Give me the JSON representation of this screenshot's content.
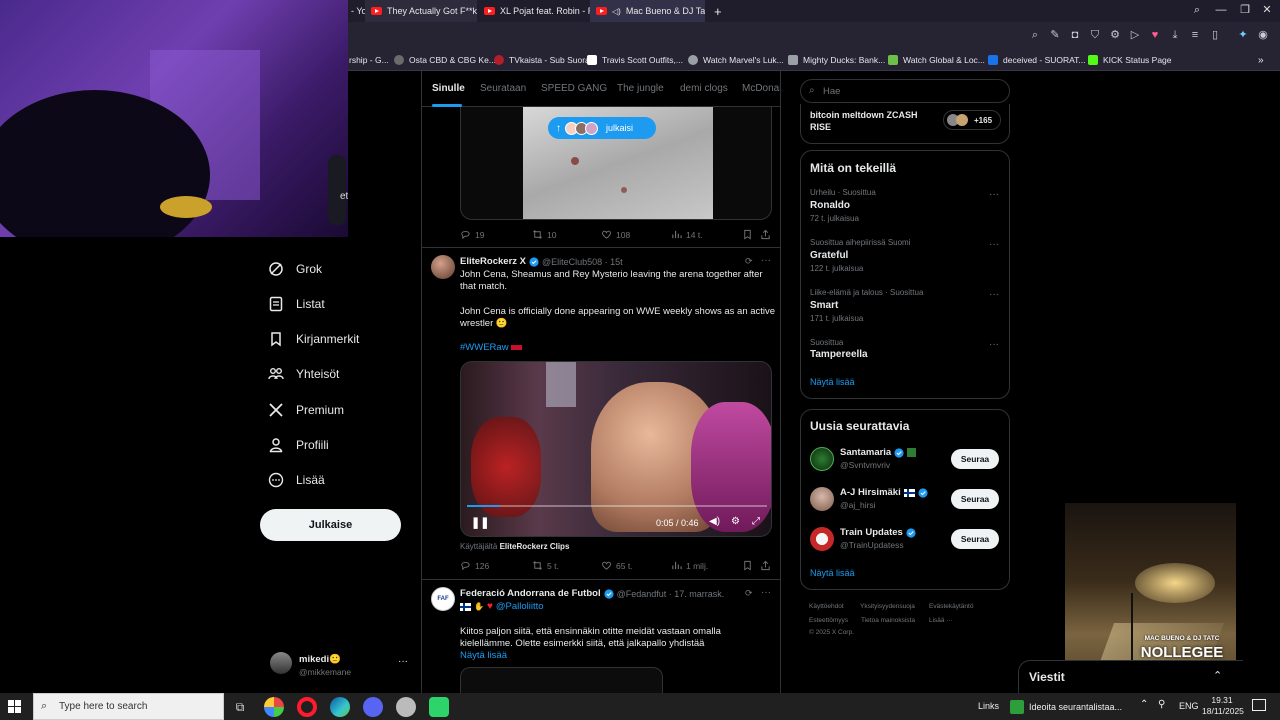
{
  "browser": {
    "tabs": [
      {
        "title": "- Yo"
      },
      {
        "title": "They Actually Got F**king"
      },
      {
        "title": "XL Pojat feat. Robin - Rom"
      },
      {
        "title": "Mac Bueno & DJ Tatc"
      }
    ],
    "bookmarks": [
      {
        "label": "rship - G...",
        "color": "#4b6b8a"
      },
      {
        "label": "Osta CBD & CBG Ke...",
        "color": "#6b6b6b"
      },
      {
        "label": "TVkaista - Sub Suora",
        "color": "#b31e2b"
      },
      {
        "label": "Travis Scott Outfits,...",
        "color": "#ffffff"
      },
      {
        "label": "Watch Marvel's Luk...",
        "color": "#9aa0a6"
      },
      {
        "label": "Mighty Ducks: Bank...",
        "color": "#9aa0a6"
      },
      {
        "label": "Watch Global & Loc...",
        "color": "#6cc04a"
      },
      {
        "label": "deceived - SUORAT...",
        "color": "#1a73e8"
      },
      {
        "label": "KICK Status Page",
        "color": "#53fc18"
      }
    ]
  },
  "webcam": {
    "partial_text": "et"
  },
  "nav": {
    "items": [
      {
        "label": "Grok",
        "icon": "grok-icon"
      },
      {
        "label": "Listat",
        "icon": "list-icon"
      },
      {
        "label": "Kirjanmerkit",
        "icon": "bookmark-icon"
      },
      {
        "label": "Yhteisöt",
        "icon": "communities-icon"
      },
      {
        "label": "Premium",
        "icon": "x-logo-icon"
      },
      {
        "label": "Profiili",
        "icon": "profile-icon"
      },
      {
        "label": "Lisää",
        "icon": "more-icon"
      }
    ],
    "post_label": "Julkaise",
    "profile": {
      "name": "mikedi🙂",
      "handle": "@mikkemane"
    }
  },
  "feed": {
    "tabs": [
      "Sinulle",
      "Seurataan",
      "SPEED GANG",
      "The jungle",
      "demi clogs",
      "McDonal"
    ],
    "new_posts_pill": "julkaisi",
    "top_tweet_metrics": {
      "replies": "19",
      "reposts": "10",
      "likes": "108",
      "views": "14 t."
    },
    "tweet1": {
      "name": "EliteRockerz X",
      "handle": "@EliteClub508 · 15t",
      "text1": "John Cena, Sheamus and Rey Mysterio leaving the arena together after that match.",
      "text2": "John Cena is officially done appearing on WWE weekly shows as an active wrestler 🙂",
      "hashtag": "#WWERaw",
      "video_time": "0:05 / 0:46",
      "from_prefix": "Käyttäjältä",
      "from_source": "EliteRockerz Clips",
      "metrics": {
        "replies": "126",
        "reposts": "5 t.",
        "likes": "65 t.",
        "views": "1 milj."
      }
    },
    "tweet2": {
      "name": "Federació Andorrana de Futbol",
      "handle": "@Fedandfut · 17. marrask.",
      "mention": "@Palloliitto",
      "text": "Kiitos paljon siitä, että ensinnäkin otitte meidät vastaan omalla kielellämme. Olette esimerkki siitä, että jalkapallo yhdistää",
      "show_more": "Näytä lisää"
    }
  },
  "right": {
    "search_placeholder": "Hae",
    "top_trend": {
      "title": "bitcoin meltdown ZCASH RISE",
      "count": "+165"
    },
    "trending_title": "Mitä on tekeillä",
    "trends": [
      {
        "meta": "Urheilu · Suosittua",
        "name": "Ronaldo",
        "posts": "72 t. julkaisua"
      },
      {
        "meta": "Suosittua aihepiirissä Suomi",
        "name": "Grateful",
        "posts": "122 t. julkaisua"
      },
      {
        "meta": "Liike-elämä ja talous · Suosittua",
        "name": "Smart",
        "posts": "171 t. julkaisua"
      },
      {
        "meta": "Suosittua",
        "name": "Tampereella",
        "posts": ""
      }
    ],
    "trends_show_more": "Näytä lisää",
    "who_title": "Uusia seurattavia",
    "who": [
      {
        "name": "Santamaria",
        "handle": "@Svntvmvriv",
        "button": "Seuraa"
      },
      {
        "name": "A-J Hirsimäki",
        "handle": "@aj_hirsi",
        "button": "Seuraa"
      },
      {
        "name": "Train Updates",
        "handle": "@TrainUpdatess",
        "button": "Seuraa"
      }
    ],
    "who_show_more": "Näytä lisää",
    "footer": [
      "Käyttöehdot",
      "Yksityisyydensuoja",
      "Evästekäytäntö",
      "Esteettömyys",
      "Tietoa mainoksista",
      "Lisää ···",
      "© 2025 X Corp."
    ]
  },
  "overlay": {
    "brand_line1": "MAC BUENO & DJ TATC",
    "brand_line2": "NOLLEGEE",
    "messages_label": "Viestit"
  },
  "taskbar": {
    "search_placeholder": "Type here to search",
    "links_label": "Links",
    "notification": "Ideoita seurantalistaa...",
    "lang": "ENG",
    "time": "19.31",
    "date": "18/11/2025"
  },
  "colors": {
    "accent": "#1d9bf0",
    "background": "#000000",
    "border": "#2f3336",
    "muted": "#71767b"
  }
}
